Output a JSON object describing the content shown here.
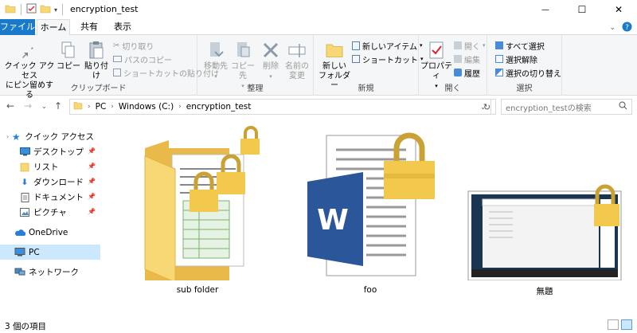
{
  "window": {
    "title": "encryption_test",
    "minimize": "—",
    "maximize": "☐",
    "close": "✕"
  },
  "tabs": {
    "file": "ファイル",
    "home": "ホーム",
    "share": "共有",
    "view": "表示"
  },
  "ribbon": {
    "clipboard": {
      "label": "クリップボード",
      "pin_line1": "クイック アクセス",
      "pin_line2": "にピン留めする",
      "copy": "コピー",
      "paste": "貼り付け",
      "cut": "切り取り",
      "copy_path": "パスのコピー",
      "paste_shortcut": "ショートカットの貼り付け"
    },
    "organize": {
      "label": "整理",
      "move_to": "移動先",
      "copy_to": "コピー先",
      "delete": "削除",
      "rename_line1": "名前の",
      "rename_line2": "変更"
    },
    "new": {
      "label": "新規",
      "new_folder_line1": "新しい",
      "new_folder_line2": "フォルダー",
      "new_item": "新しいアイテム",
      "shortcut": "ショートカット"
    },
    "open": {
      "label": "開く",
      "properties": "プロパティ",
      "open": "開く",
      "edit": "編集",
      "history": "履歴"
    },
    "select": {
      "label": "選択",
      "select_all": "すべて選択",
      "select_none": "選択解除",
      "invert": "選択の切り替え"
    }
  },
  "address": {
    "crumbs": [
      "PC",
      "Windows (C:)",
      "encryption_test"
    ],
    "search_placeholder": "encryption_testの検索"
  },
  "sidebar": {
    "quick_access": "クイック アクセス",
    "items": [
      {
        "label": "デスクトップ",
        "pinned": true
      },
      {
        "label": "リスト",
        "pinned": true
      },
      {
        "label": "ダウンロード",
        "pinned": true
      },
      {
        "label": "ドキュメント",
        "pinned": true
      },
      {
        "label": "ピクチャ",
        "pinned": true
      }
    ],
    "onedrive": "OneDrive",
    "pc": "PC",
    "network": "ネットワーク"
  },
  "files": [
    {
      "name": "sub folder",
      "type": "folder",
      "locked": true
    },
    {
      "name": "foo",
      "type": "word-document",
      "locked": true
    },
    {
      "name": "無題",
      "type": "image",
      "locked": true
    }
  ],
  "status": {
    "count": "3 個の項目"
  },
  "colors": {
    "accent": "#1979ca",
    "lock_gold": "#f2c94c",
    "folder_yellow": "#f8d775",
    "word_blue": "#2b579a",
    "selected": "#cce8ff"
  }
}
